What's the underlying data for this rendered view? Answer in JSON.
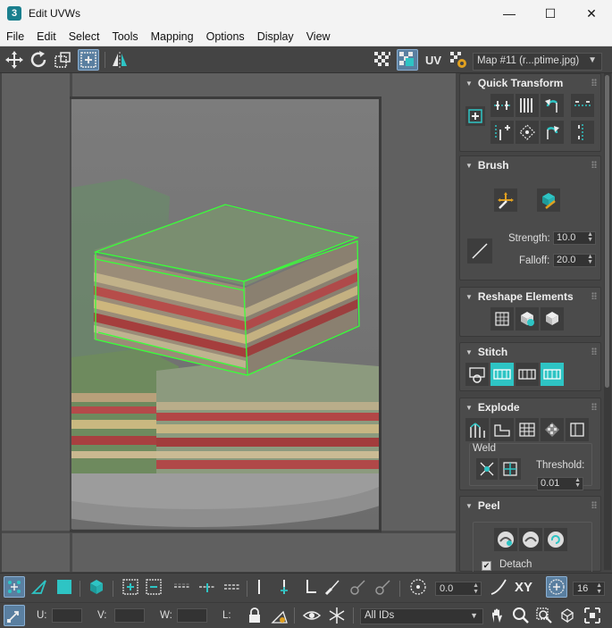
{
  "window": {
    "title": "Edit UVWs",
    "app_icon": "3",
    "minimize": "—",
    "maximize": "☐",
    "close": "✕"
  },
  "menu": [
    "File",
    "Edit",
    "Select",
    "Tools",
    "Mapping",
    "Options",
    "Display",
    "View"
  ],
  "toolbar": {
    "uv_label": "UV",
    "map_select": "Map #11 (r...ptime.jpg)"
  },
  "panel": {
    "quick_transform": {
      "title": "Quick Transform"
    },
    "brush": {
      "title": "Brush",
      "strength_label": "Strength:",
      "strength_value": "10.0",
      "falloff_label": "Falloff:",
      "falloff_value": "20.0"
    },
    "reshape": {
      "title": "Reshape Elements"
    },
    "stitch": {
      "title": "Stitch"
    },
    "explode": {
      "title": "Explode",
      "weld_label": "Weld",
      "threshold_label": "Threshold:",
      "threshold_value": "0.01"
    },
    "peel": {
      "title": "Peel",
      "detach_label": "Detach",
      "detach_checked": true
    }
  },
  "bottom": {
    "angle_value": "0.0",
    "xy_label": "XY",
    "grid_value": "16",
    "u_label": "U:",
    "v_label": "V:",
    "w_label": "W:",
    "l_label": "L:",
    "ids_select": "All IDs"
  },
  "colors": {
    "accent_teal": "#2ec4c4",
    "selection_green": "#39ff39",
    "active_blue": "#5a7fa0"
  }
}
